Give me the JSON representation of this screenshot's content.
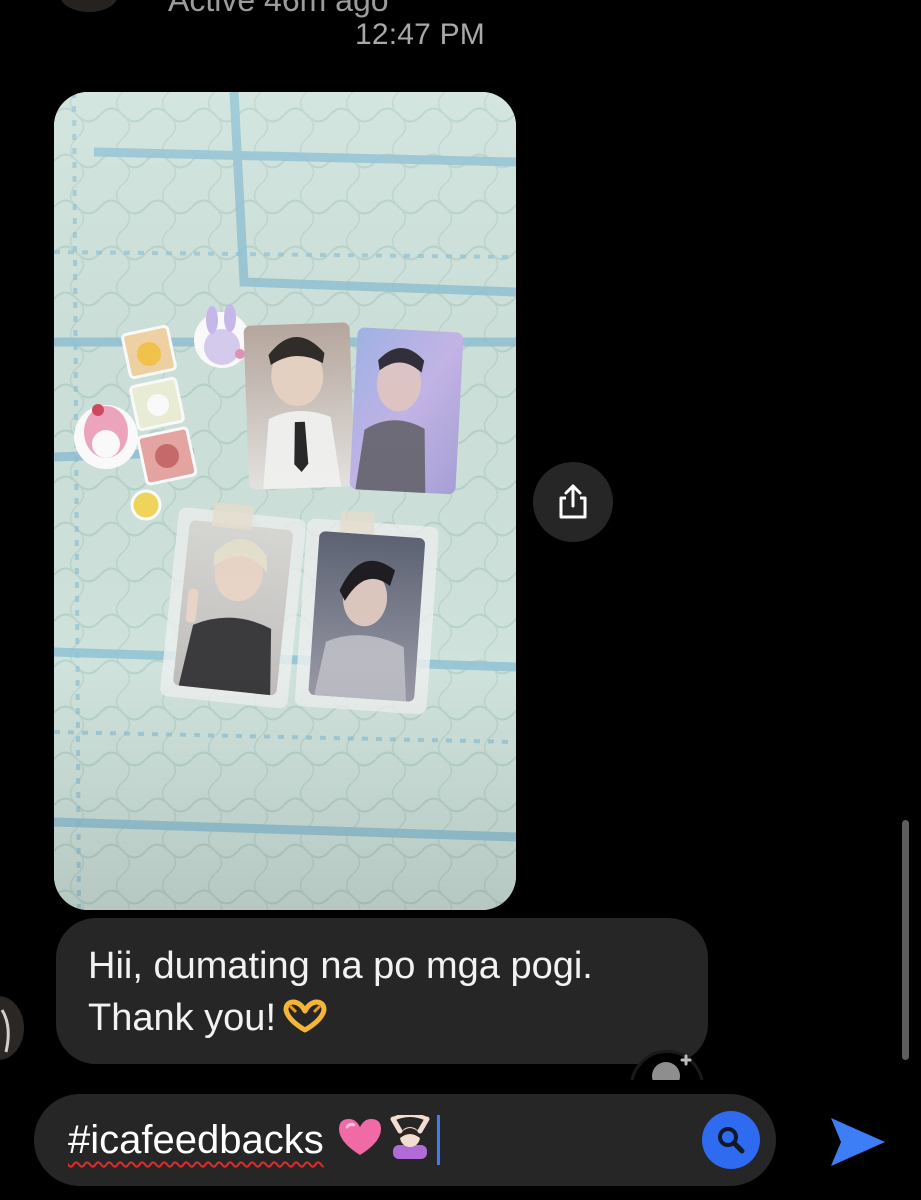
{
  "header": {
    "active_status": "Active 46m ago",
    "timestamp": "12:47 PM"
  },
  "message": {
    "line1": "Hii, dumating na po mga pogi.",
    "line2": "Thank you!",
    "line2_emoji": "heart-hands-emoji"
  },
  "composer": {
    "text": "#icafeedbacks",
    "emojis": [
      "pink-heart-emoji",
      "person-gesturing-ok-emoji"
    ],
    "search_icon": "search-icon",
    "send_icon": "send-arrow-icon"
  },
  "colors": {
    "background": "#000000",
    "bubble": "#262626",
    "accent": "#2f6bf0",
    "send": "#3d7ef7",
    "spellcheck": "#e02b2b"
  }
}
